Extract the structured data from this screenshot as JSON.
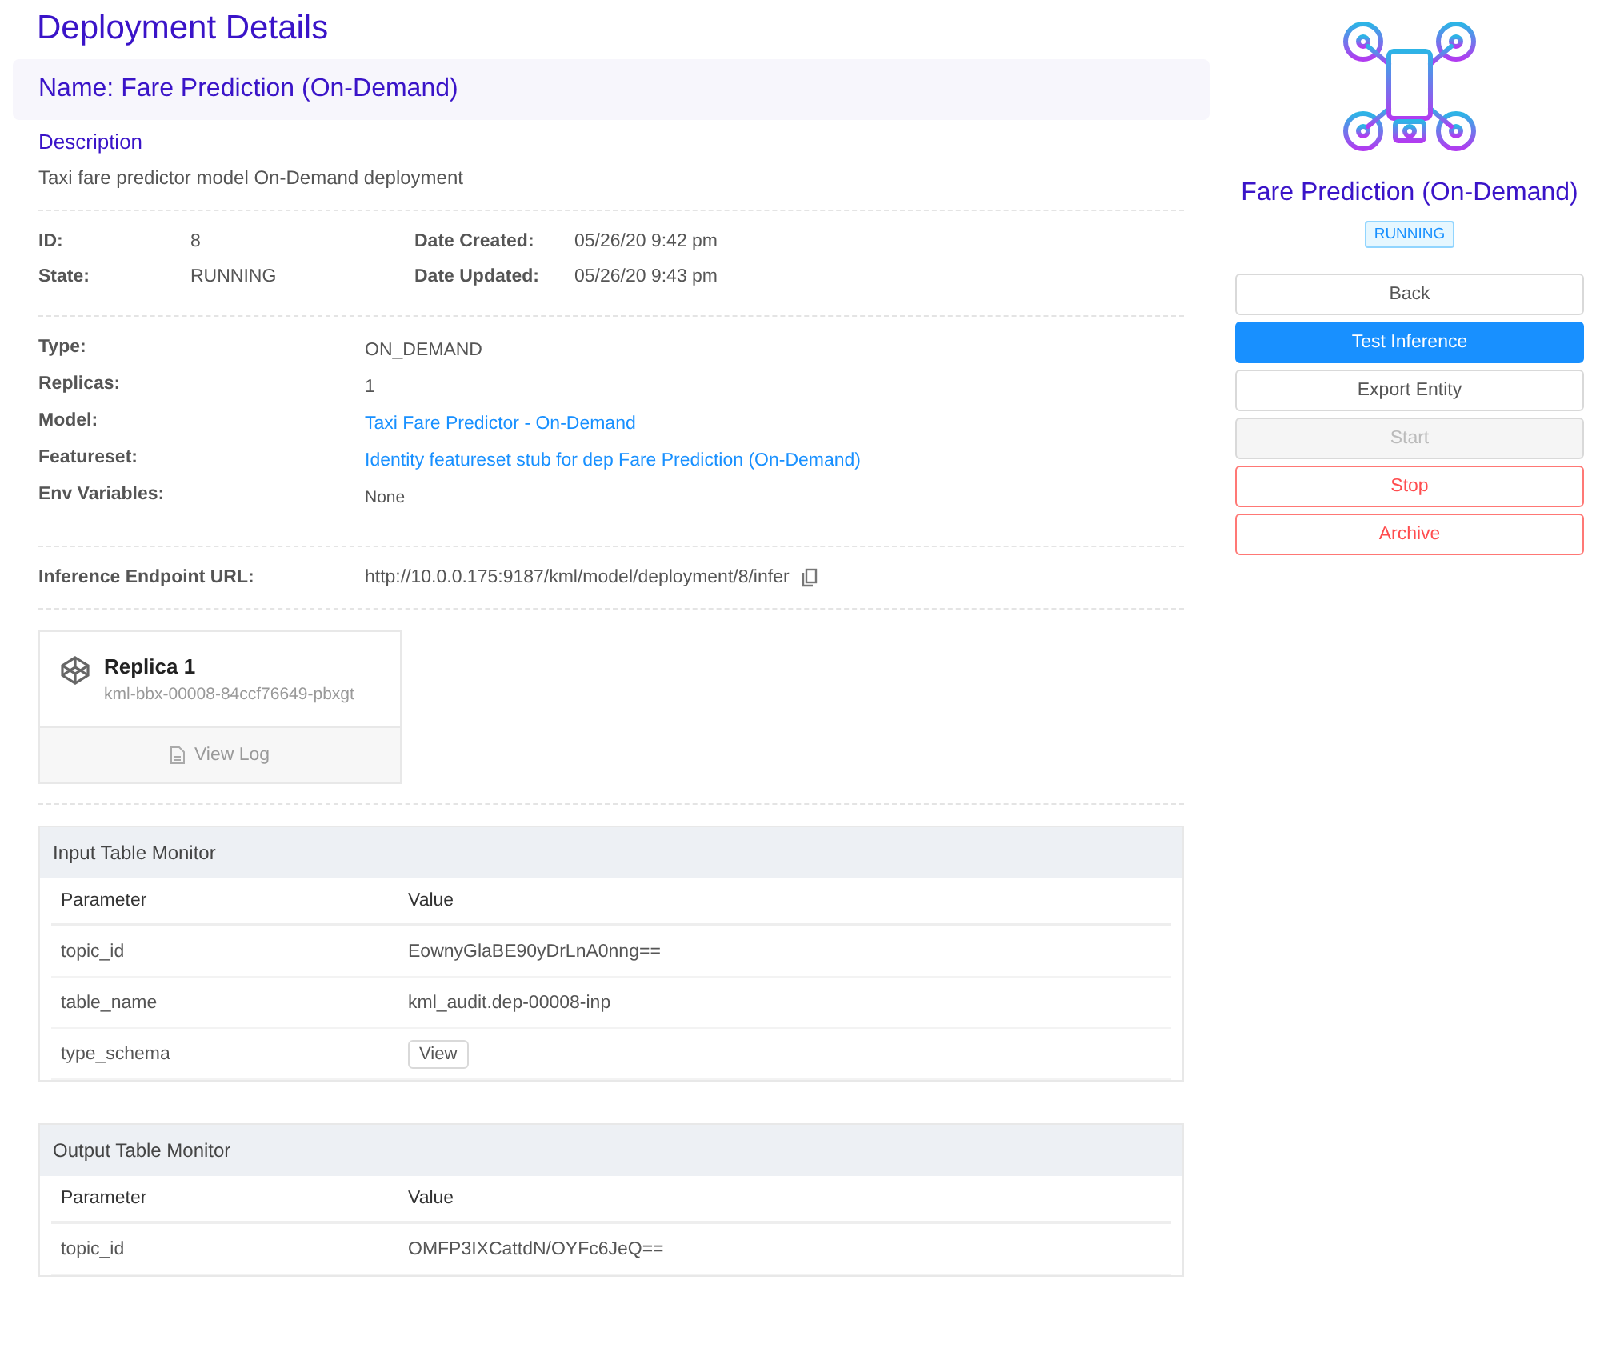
{
  "page_title": "Deployment Details",
  "name_bar": "Name: Fare Prediction (On-Demand)",
  "description": {
    "label": "Description",
    "text": "Taxi fare predictor model On-Demand deployment"
  },
  "summary": [
    {
      "label": "ID:",
      "value": "8"
    },
    {
      "label": "Date Created:",
      "value": "05/26/20 9:42 pm"
    },
    {
      "label": "State:",
      "value": "RUNNING"
    },
    {
      "label": "Date Updated:",
      "value": "05/26/20 9:43 pm"
    }
  ],
  "details": [
    {
      "label": "Type:",
      "value": "ON_DEMAND",
      "kind": "text"
    },
    {
      "label": "Replicas:",
      "value": "1",
      "kind": "text"
    },
    {
      "label": "Model:",
      "value": "Taxi Fare Predictor - On-Demand",
      "kind": "link"
    },
    {
      "label": "Featureset:",
      "value": "Identity featureset stub for dep Fare Prediction (On-Demand)",
      "kind": "link"
    },
    {
      "label": "Env Variables:",
      "value": "None",
      "kind": "small"
    }
  ],
  "endpoint": {
    "label": "Inference Endpoint URL:",
    "value": "http://10.0.0.175:9187/kml/model/deployment/8/infer"
  },
  "replicas": [
    {
      "title": "Replica 1",
      "pod": "kml-bbx-00008-84ccf76649-pbxgt",
      "action": "View Log"
    }
  ],
  "monitors": [
    {
      "title": "Input Table Monitor",
      "columns": [
        "Parameter",
        "Value"
      ],
      "rows": [
        {
          "parameter": "topic_id",
          "value": "EownyGlaBE90yDrLnA0nng==",
          "kind": "text"
        },
        {
          "parameter": "table_name",
          "value": "kml_audit.dep-00008-inp",
          "kind": "text"
        },
        {
          "parameter": "type_schema",
          "value": "View",
          "kind": "button"
        }
      ]
    },
    {
      "title": "Output Table Monitor",
      "columns": [
        "Parameter",
        "Value"
      ],
      "rows": [
        {
          "parameter": "topic_id",
          "value": "OMFP3IXCattdN/OYFc6JeQ==",
          "kind": "text"
        }
      ]
    }
  ],
  "sidebar": {
    "title": "Fare Prediction (On-Demand)",
    "status": "RUNNING",
    "buttons": [
      {
        "label": "Back",
        "kind": "default",
        "disabled": false
      },
      {
        "label": "Test Inference",
        "kind": "primary",
        "disabled": false
      },
      {
        "label": "Export Entity",
        "kind": "default",
        "disabled": false
      },
      {
        "label": "Start",
        "kind": "default",
        "disabled": true
      },
      {
        "label": "Stop",
        "kind": "danger",
        "disabled": false
      },
      {
        "label": "Archive",
        "kind": "danger",
        "disabled": false
      }
    ]
  }
}
